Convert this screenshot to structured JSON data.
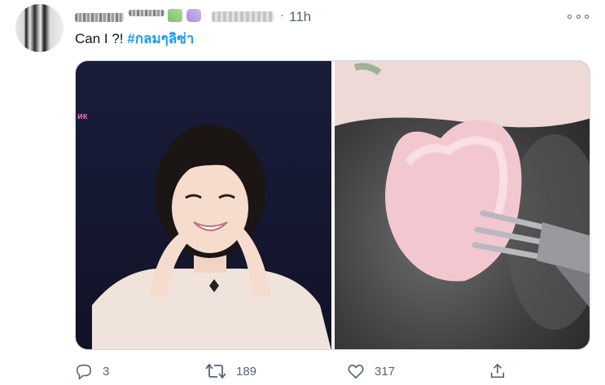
{
  "tweet": {
    "timestamp": "11h",
    "text": "Can I ?!",
    "hashtag": "#กลมๆลิซ่า"
  },
  "media": {
    "left_overlay_text": "ик"
  },
  "actions": {
    "reply_count": "3",
    "retweet_count": "189",
    "like_count": "317"
  },
  "icons": {
    "more": "more-icon",
    "reply": "reply-icon",
    "retweet": "retweet-icon",
    "like": "heart-icon",
    "share": "share-icon"
  },
  "colors": {
    "accent": "#1d9bf0",
    "secondary_text": "#536471",
    "primary_text": "#0f1419"
  }
}
